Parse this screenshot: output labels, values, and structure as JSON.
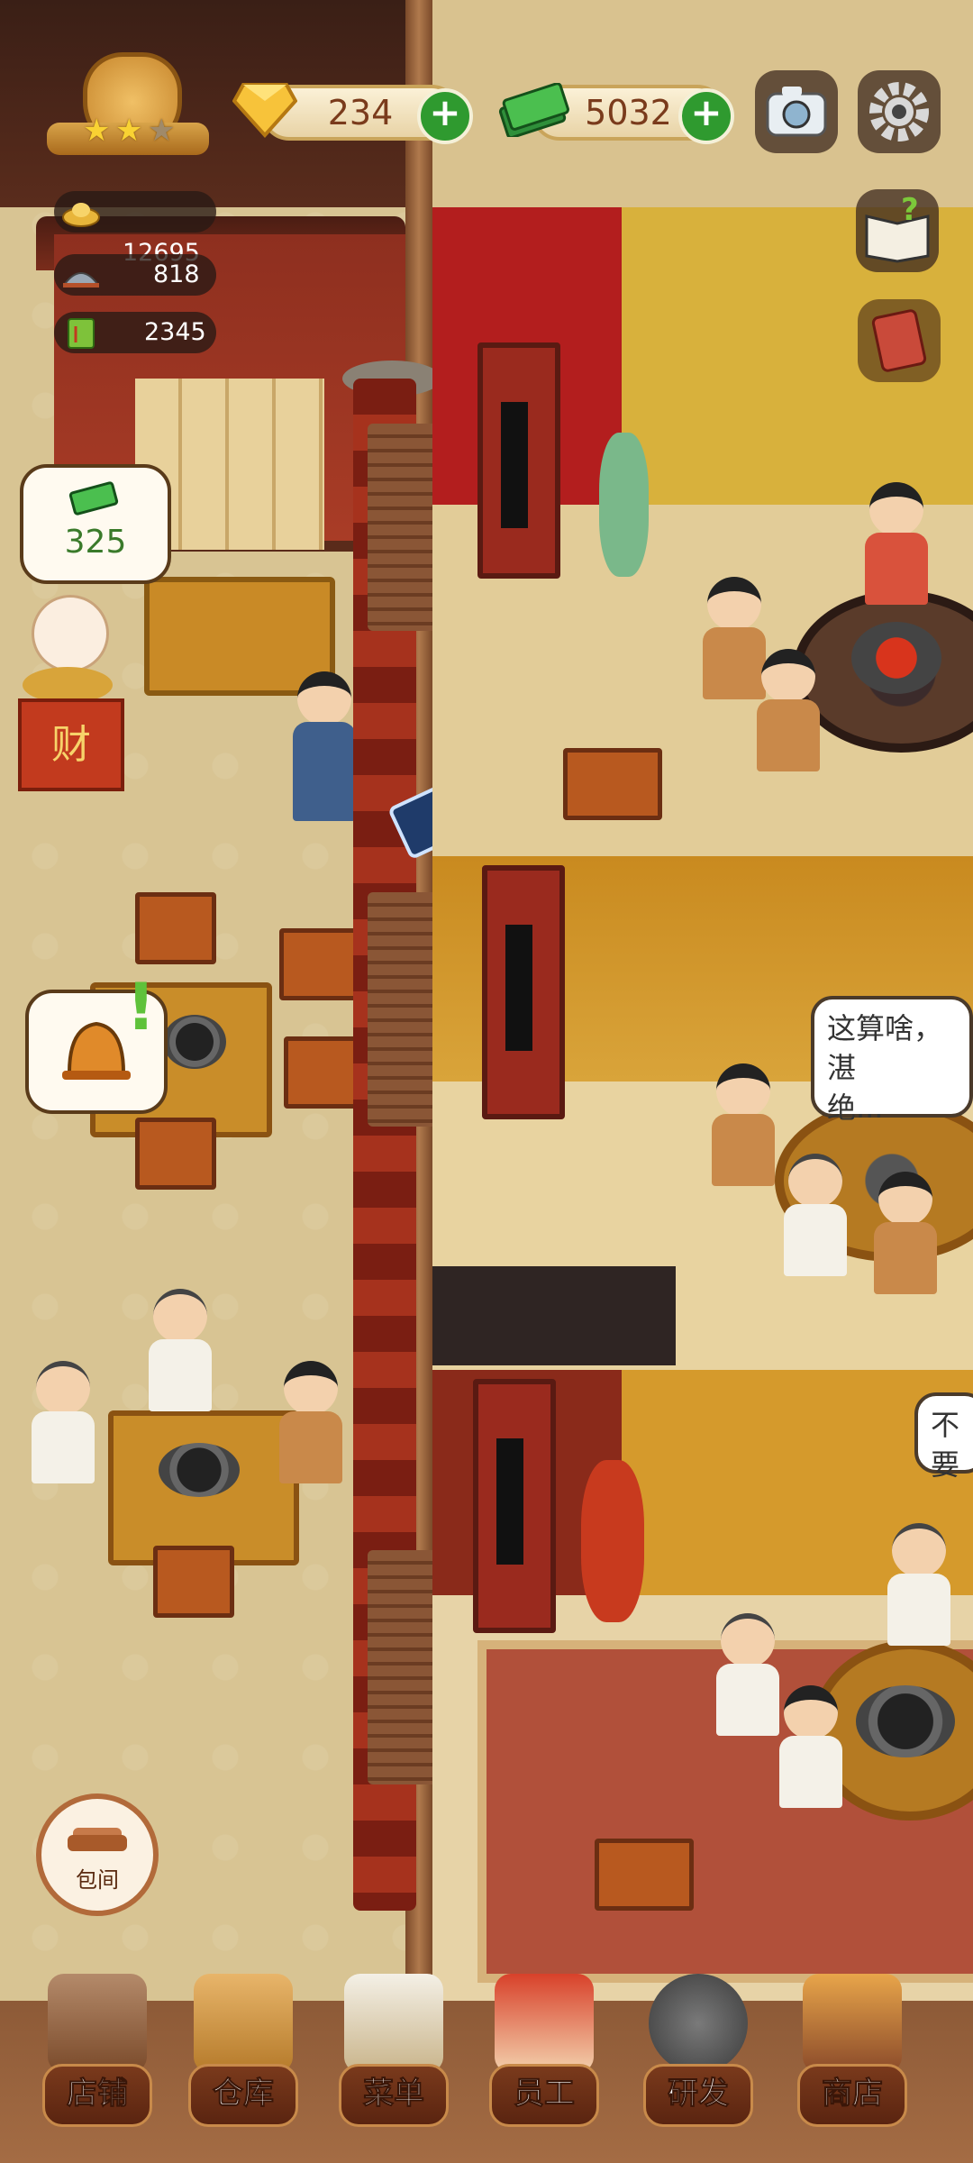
{
  "hud": {
    "gems": "234",
    "cash": "5032",
    "stats": {
      "coins": "12695",
      "dishes": "818",
      "menu_points": "2345"
    }
  },
  "tip_bubble": {
    "value": "325"
  },
  "lucky_cat": {
    "sign": "财"
  },
  "private_room_button": {
    "label": "包间"
  },
  "speech": {
    "room2": "这算啥，湛\n绝...",
    "room3": "不要"
  },
  "nav": [
    {
      "label": "店铺",
      "icon": "shop-house-icon"
    },
    {
      "label": "仓库",
      "icon": "warehouse-boxes-icon"
    },
    {
      "label": "菜单",
      "icon": "menu-clipboard-icon"
    },
    {
      "label": "员工",
      "icon": "staff-chef-icon"
    },
    {
      "label": "研发",
      "icon": "research-wok-icon"
    },
    {
      "label": "商店",
      "icon": "store-front-icon"
    }
  ],
  "colors": {
    "accent_green": "#2f9a2f",
    "nav_label": "#5a2410",
    "stat_pill": "#281914"
  }
}
